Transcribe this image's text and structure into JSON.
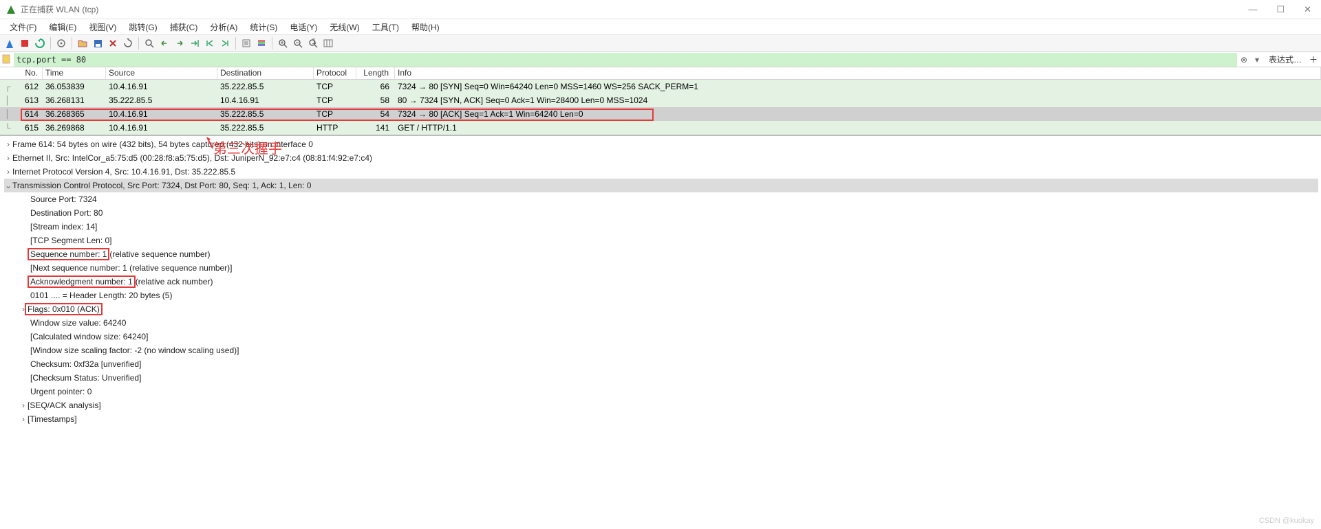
{
  "window": {
    "title": "正在捕获 WLAN (tcp)"
  },
  "menu": [
    "文件(F)",
    "编辑(E)",
    "视图(V)",
    "跳转(G)",
    "捕获(C)",
    "分析(A)",
    "统计(S)",
    "电话(Y)",
    "无线(W)",
    "工具(T)",
    "帮助(H)"
  ],
  "filter": {
    "value": "tcp.port == 80",
    "label": "表达式…"
  },
  "columns": {
    "no": "No.",
    "time": "Time",
    "src": "Source",
    "dst": "Destination",
    "proto": "Protocol",
    "len": "Length",
    "info": "Info"
  },
  "packets": [
    {
      "no": "612",
      "time": "36.053839",
      "src": "10.4.16.91",
      "dst": "35.222.85.5",
      "proto": "TCP",
      "len": "66",
      "info": "7324 → 80 [SYN] Seq=0 Win=64240 Len=0 MSS=1460 WS=256 SACK_PERM=1",
      "cls": "row-syn"
    },
    {
      "no": "613",
      "time": "36.268131",
      "src": "35.222.85.5",
      "dst": "10.4.16.91",
      "proto": "TCP",
      "len": "58",
      "info": "80 → 7324 [SYN, ACK] Seq=0 Ack=1 Win=28400 Len=0 MSS=1024",
      "cls": "row-syn"
    },
    {
      "no": "614",
      "time": "36.268365",
      "src": "10.4.16.91",
      "dst": "35.222.85.5",
      "proto": "TCP",
      "len": "54",
      "info": "7324 → 80 [ACK] Seq=1 Ack=1 Win=64240 Len=0",
      "cls": "row-sel"
    },
    {
      "no": "615",
      "time": "36.269868",
      "src": "10.4.16.91",
      "dst": "35.222.85.5",
      "proto": "HTTP",
      "len": "141",
      "info": "GET / HTTP/1.1",
      "cls": "row-http"
    }
  ],
  "annotation": "第三次握手",
  "details": {
    "frame": "Frame 614: 54 bytes on wire (432 bits), 54 bytes captured (432 bits) on interface 0",
    "eth": "Ethernet II, Src: IntelCor_a5:75:d5 (00:28:f8:a5:75:d5), Dst: JuniperN_92:e7:c4 (08:81:f4:92:e7:c4)",
    "ip": "Internet Protocol Version 4, Src: 10.4.16.91, Dst: 35.222.85.5",
    "tcp": "Transmission Control Protocol, Src Port: 7324, Dst Port: 80, Seq: 1, Ack: 1, Len: 0",
    "srcport": "Source Port: 7324",
    "dstport": "Destination Port: 80",
    "stream": "[Stream index: 14]",
    "seglen": "[TCP Segment Len: 0]",
    "seq": "Sequence number: 1",
    "seqnote": "    (relative sequence number)",
    "nextseq": "[Next sequence number: 1    (relative sequence number)]",
    "ack": "Acknowledgment number: 1",
    "acknote": "    (relative ack number)",
    "hdrlen": "0101 .... = Header Length: 20 bytes (5)",
    "flags": "Flags: 0x010 (ACK)",
    "win": "Window size value: 64240",
    "calcwin": "[Calculated window size: 64240]",
    "winscale": "[Window size scaling factor: -2 (no window scaling used)]",
    "chk": "Checksum: 0xf32a [unverified]",
    "chkstat": "[Checksum Status: Unverified]",
    "urg": "Urgent pointer: 0",
    "seqack": "[SEQ/ACK analysis]",
    "ts": "[Timestamps]"
  },
  "watermark": "CSDN @kuokay"
}
